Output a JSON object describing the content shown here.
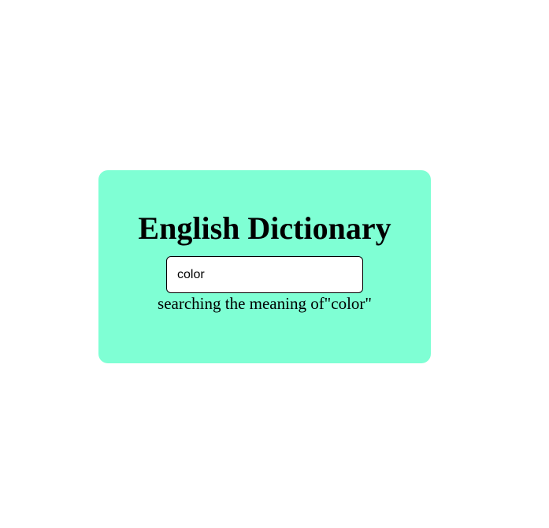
{
  "app": {
    "title": "English Dictionary"
  },
  "search": {
    "value": "color",
    "placeholder": ""
  },
  "status": {
    "text": "searching the meaning of\"color\""
  },
  "colors": {
    "card_background": "#7fffd4",
    "page_background": "#ffffff",
    "text": "#000000"
  }
}
